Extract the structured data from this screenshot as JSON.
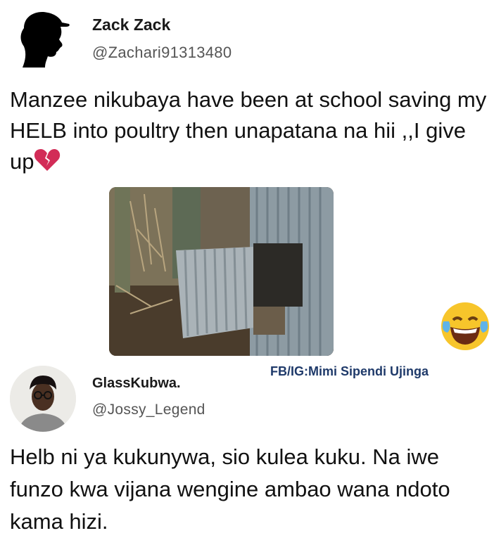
{
  "tweet1": {
    "display_name": "Zack Zack",
    "handle": "@Zachari91313480",
    "text": "Manzee nikubaya have been at school saving my HELB into poultry then unapatana na hii ,,I give up",
    "emoji": "broken-heart-icon"
  },
  "watermark": "FB/IG:Mimi Sipendi Ujinga",
  "reaction_emoji": "tears-of-joy-icon",
  "tweet2": {
    "display_name": "GlassKubwa.",
    "handle": "@Jossy_Legend",
    "text": "Helb ni ya kukunywa, sio kulea kuku. Na iwe funzo kwa vijana wengine ambao wana ndoto kama hizi."
  }
}
